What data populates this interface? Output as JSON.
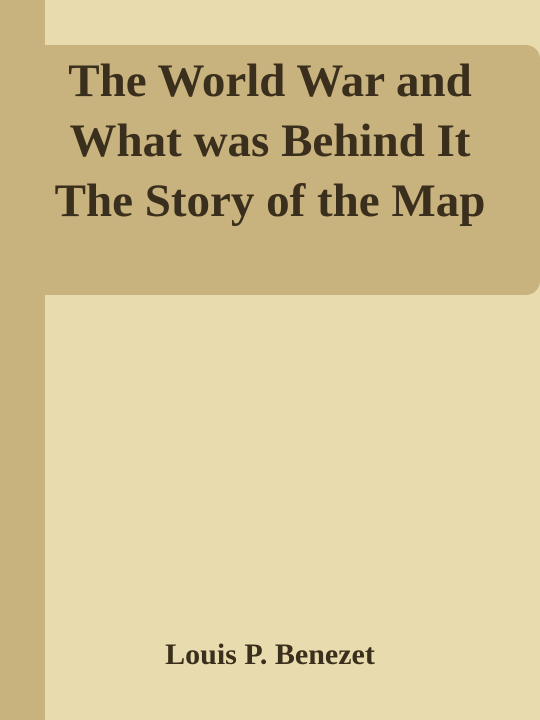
{
  "cover": {
    "title": "The World War and What was Behind It The Story of the Map",
    "author": "Louis P. Benezet"
  },
  "colors": {
    "background": "#e8dcae",
    "band": "#c8b27e",
    "text": "#3a2f1c"
  }
}
